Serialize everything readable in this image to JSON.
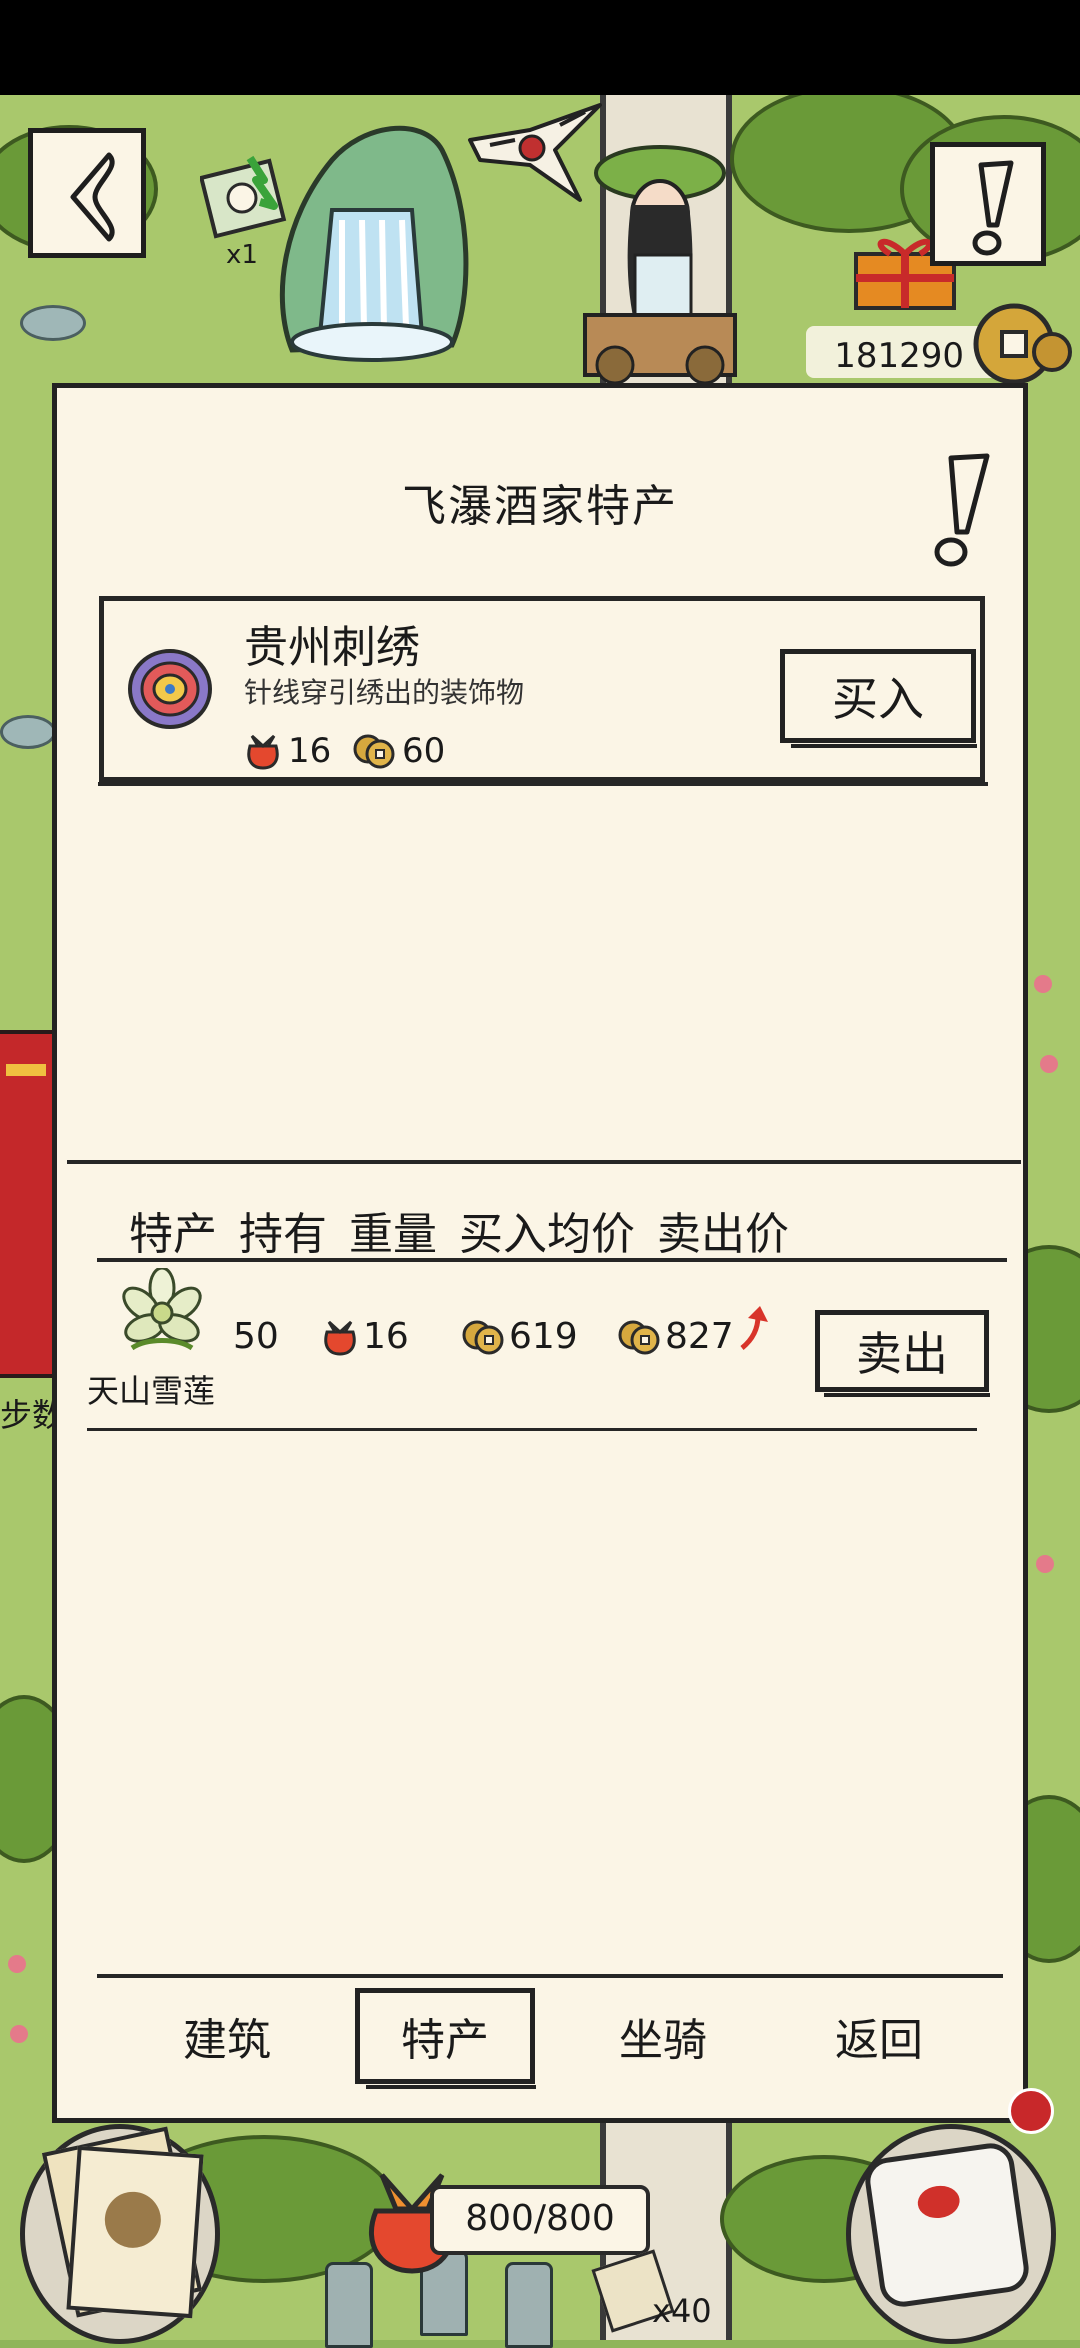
{
  "status_bar": {},
  "top_hud": {
    "ticket_count": "x1",
    "money": "181290"
  },
  "side_label": "步数",
  "panel": {
    "title": "飞瀑酒家特产",
    "product": {
      "name": "贵州刺绣",
      "description": "针线穿引绣出的装饰物",
      "weight": "16",
      "price": "60",
      "buy_label": "买入"
    },
    "table_headers": [
      "特产",
      "持有",
      "重量",
      "买入均价",
      "卖出价"
    ],
    "holdings": [
      {
        "name": "天山雪莲",
        "owned": "50",
        "weight": "16",
        "avg_buy_price": "619",
        "sell_price": "827",
        "trend": "up",
        "sell_label": "卖出"
      }
    ],
    "tabs": [
      {
        "label": "建筑",
        "active": false
      },
      {
        "label": "特产",
        "active": true
      },
      {
        "label": "坐骑",
        "active": false
      },
      {
        "label": "返回",
        "active": false
      }
    ]
  },
  "bottom_hud": {
    "stamina": "800/800",
    "ticket_count": "x40"
  },
  "colors": {
    "paper": "#fbf5e6",
    "ink": "#222222",
    "trend_up": "#d8342a",
    "map_green": "#a9c86c"
  }
}
